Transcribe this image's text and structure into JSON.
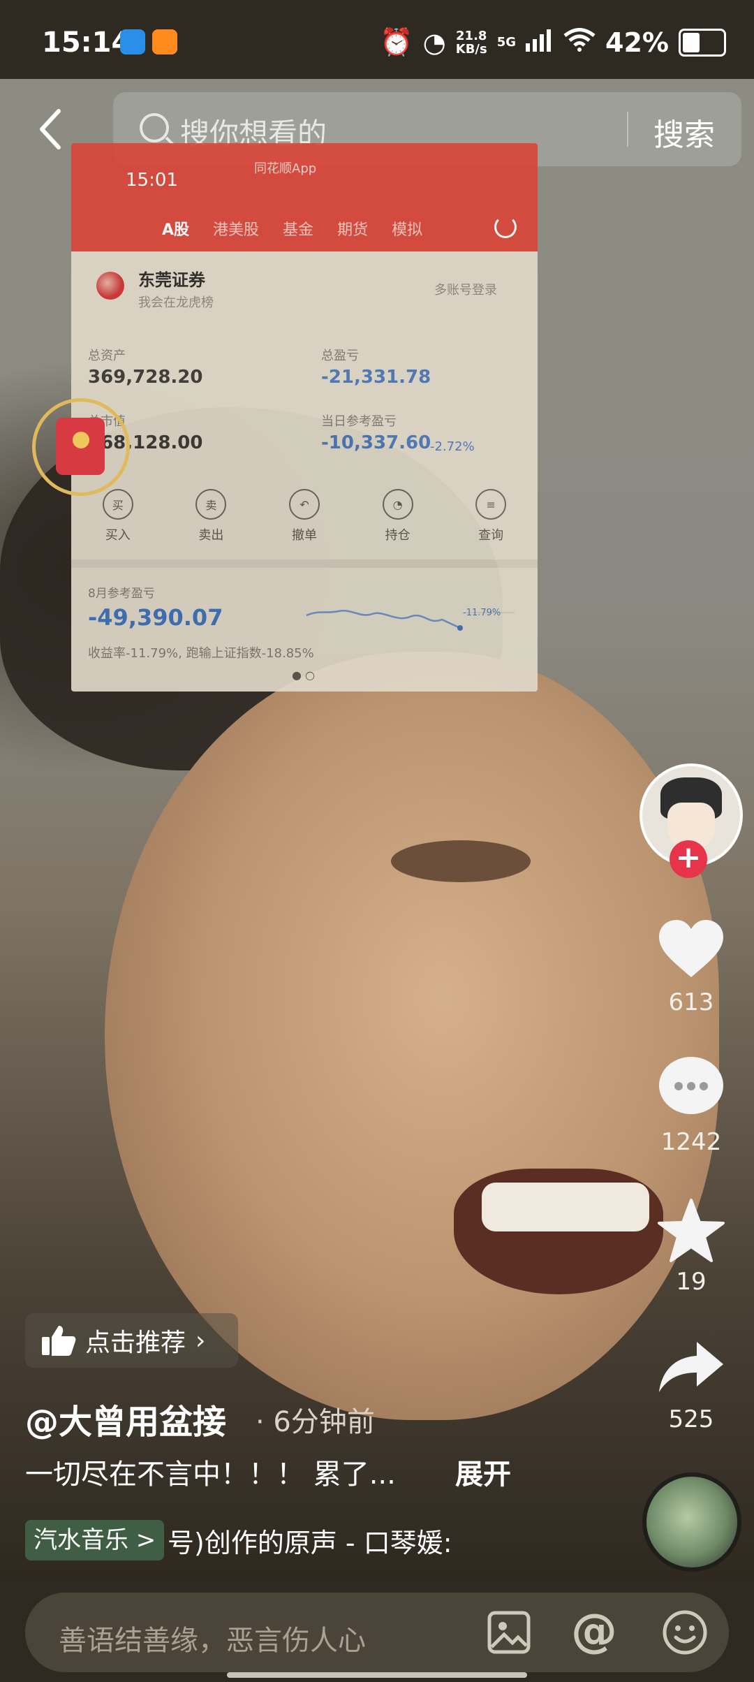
{
  "status_bar": {
    "time": "15:14",
    "net_speed_value": "21.8",
    "net_speed_unit": "KB/s",
    "network": "5G",
    "battery": "42%"
  },
  "search": {
    "placeholder": "搜你想看的",
    "button_label": "搜索"
  },
  "embedded_screenshot": {
    "time": "15:01",
    "app_name": "同花顺App",
    "tabs": [
      "A股",
      "港美股",
      "基金",
      "期货",
      "模拟"
    ],
    "broker": "东莞证券",
    "slogan": "我会在龙虎榜",
    "multi_account": "多账号登录",
    "total_assets_label": "总资产",
    "total_assets_value": "369,728.20",
    "total_pnl_label": "总盈亏",
    "total_pnl_value": "-21,331.78",
    "market_value_label": "总市值",
    "market_value_value": "368,128.00",
    "daily_pnl_label": "当日参考盈亏",
    "daily_pnl_value": "-10,337.60",
    "daily_pnl_pct": "-2.72%",
    "ops": [
      {
        "icon": "买",
        "label": "买入"
      },
      {
        "icon": "卖",
        "label": "卖出"
      },
      {
        "icon": "↶",
        "label": "撤单"
      },
      {
        "icon": "◔",
        "label": "持仓"
      },
      {
        "icon": "≡",
        "label": "查询"
      }
    ],
    "month_label": "8月参考盈亏",
    "month_value": "-49,390.07",
    "month_ratio": "收益率-11.79%, 跑输上证指数-18.85%",
    "spark_label": "-11.79%"
  },
  "rail": {
    "likes": "613",
    "comments": "1242",
    "favorites": "19",
    "shares": "525"
  },
  "post": {
    "recommend_label": "点击推荐",
    "author": "@大曾用盆接",
    "time_ago": "· 6分钟前",
    "description": "一切尽在不言中！！！ 累了...",
    "expand_label": "展开",
    "music_tag": "汽水音乐 >",
    "music_title": "号)创作的原声 - 口琴媛:"
  },
  "comment_bar": {
    "placeholder": "善语结善缘，恶言伤人心"
  },
  "colors": {
    "like": "#ffffff",
    "follow": "#e6344a",
    "card_header": "#d9473a",
    "loss_blue": "#4c78b8"
  }
}
